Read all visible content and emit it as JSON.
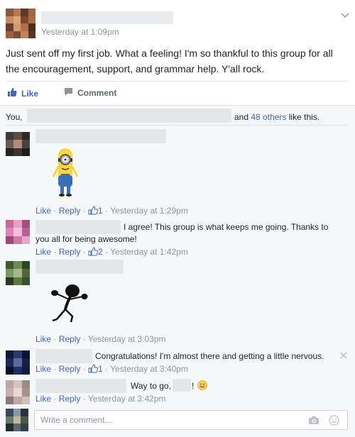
{
  "post": {
    "timestamp": "Yesterday at 1:09pm",
    "text": "Just sent off my first job. What a feeling! I'm so thankful to this group for all the encouragement, support, and grammar help. Y'all rock.",
    "actions": {
      "like": "Like",
      "comment": "Comment"
    }
  },
  "likes_summary": {
    "prefix": "You,",
    "middle": "and",
    "others_link": "48 others",
    "suffix": "like this."
  },
  "comments": [
    {
      "text": "",
      "sticker": "minion-sticker",
      "like": "Like",
      "reply": "Reply",
      "like_count": "1",
      "timestamp": "Yesterday at 1:29pm"
    },
    {
      "text_line1": "I agree! This group is what keeps me going. Thanks to",
      "text_line2": "you all for being awesome!",
      "like": "Like",
      "reply": "Reply",
      "like_count": "2",
      "timestamp": "Yesterday at 1:42pm"
    },
    {
      "text": "",
      "sticker": "dancing-figure-sticker",
      "like": "Like",
      "reply": "Reply",
      "timestamp": "Yesterday at 3:03pm"
    },
    {
      "text": "Congratulations! I'm almost there and getting a little nervous.",
      "like": "Like",
      "reply": "Reply",
      "like_count": "1",
      "timestamp": "Yesterday at 3:40pm"
    },
    {
      "text_before": "Way to go,",
      "text_after": "!",
      "like": "Like",
      "reply": "Reply",
      "timestamp": "Yesterday at 3:42pm"
    }
  ],
  "composer": {
    "placeholder": "Write a comment..."
  },
  "colors": {
    "link": "#4267b2",
    "meta": "#90949c",
    "background": "#f6f7f9"
  }
}
